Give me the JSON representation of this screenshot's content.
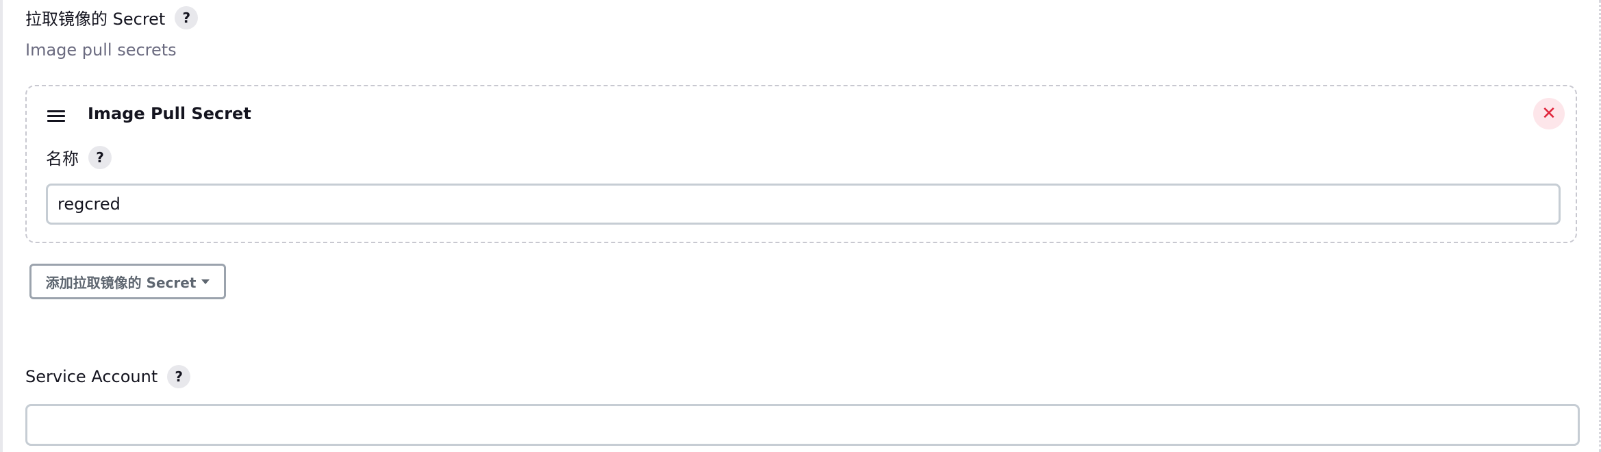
{
  "image_pull_secrets": {
    "label": "拉取镜像的 Secret",
    "help_icon": "?",
    "description": "Image pull secrets",
    "items": [
      {
        "title": "Image Pull Secret",
        "delete_icon": "✕",
        "name_label": "名称",
        "name_help_icon": "?",
        "name_value": "regcred"
      }
    ],
    "add_button_label": "添加拉取镜像的 Secret"
  },
  "service_account": {
    "label": "Service Account",
    "help_icon": "?",
    "value": ""
  },
  "colors": {
    "delete_accent": "#e0243a",
    "delete_background": "#fde6ea",
    "description_text": "#6b6b80",
    "input_border": "#c6cdd4"
  }
}
